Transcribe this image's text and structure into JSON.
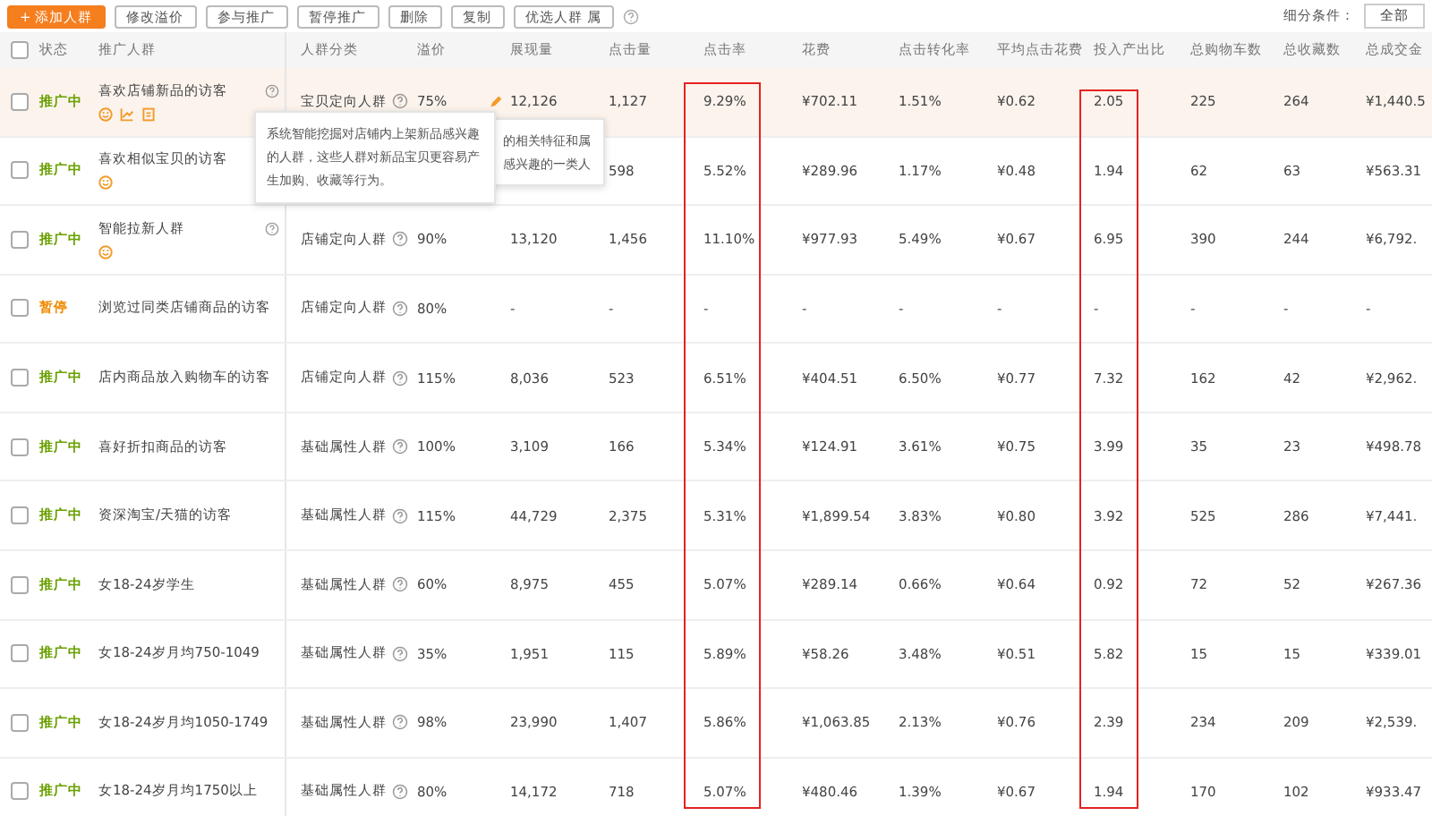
{
  "toolbar": {
    "buttons": [
      {
        "label": "+ 添加人群",
        "kind": "primary"
      },
      {
        "label": "修改溢价",
        "kind": "normal"
      },
      {
        "label": "参与推广",
        "kind": "normal"
      },
      {
        "label": "暂停推广",
        "kind": "normal"
      },
      {
        "label": "删除",
        "kind": "normal"
      },
      {
        "label": "复制",
        "kind": "normal"
      },
      {
        "label": "优选人群 属",
        "kind": "normal"
      }
    ],
    "filter_label": "细分条件：",
    "filter_value": "全部"
  },
  "table": {
    "select_all": {
      "checked": false
    },
    "columns": [
      "状态",
      "推广人群",
      "人群分类",
      "溢价",
      "展现量",
      "点击量",
      "点击率",
      "花费",
      "点击转化率",
      "平均点击花费",
      "投入产出比",
      "总购物车数",
      "总收藏数",
      "总成交金"
    ],
    "rows": [
      {
        "selected": true,
        "checked": false,
        "kind": "active",
        "name_help": true,
        "icons": [
          {
            "kind": "smile"
          },
          {
            "kind": "trend"
          },
          {
            "kind": "box"
          }
        ],
        "edit": true,
        "cells": [
          "推广中",
          "喜欢店铺新品的访客",
          "宝贝定向人群",
          "75%",
          "12,126",
          "1,127",
          "9.29%",
          "¥702.11",
          "1.51%",
          "¥0.62",
          "2.05",
          "225",
          "264",
          "¥1,440.5"
        ]
      },
      {
        "selected": false,
        "checked": false,
        "kind": "active",
        "name_help": false,
        "icons": [
          {
            "kind": "smile"
          }
        ],
        "edit": false,
        "cells": [
          "推广中",
          "喜欢相似宝贝的访客",
          null,
          null,
          null,
          "598",
          "5.52%",
          "¥289.96",
          "1.17%",
          "¥0.48",
          "1.94",
          "62",
          "63",
          "¥563.31"
        ]
      },
      {
        "selected": false,
        "checked": false,
        "kind": "active",
        "name_help": true,
        "icons": [
          {
            "kind": "smile"
          }
        ],
        "edit": false,
        "cells": [
          "推广中",
          "智能拉新人群",
          "店铺定向人群",
          "90%",
          "13,120",
          "1,456",
          "11.10%",
          "¥977.93",
          "5.49%",
          "¥0.67",
          "6.95",
          "390",
          "244",
          "¥6,792."
        ]
      },
      {
        "selected": false,
        "checked": false,
        "kind": "paused",
        "name_help": false,
        "icons": [],
        "edit": false,
        "cells": [
          "暂停",
          "浏览过同类店铺商品的访客",
          "店铺定向人群",
          "80%",
          "-",
          "-",
          "-",
          "-",
          "-",
          "-",
          "-",
          "-",
          "-",
          "-"
        ]
      },
      {
        "selected": false,
        "checked": false,
        "kind": "active",
        "name_help": false,
        "icons": [],
        "edit": false,
        "cells": [
          "推广中",
          "店内商品放入购物车的访客",
          "店铺定向人群",
          "115%",
          "8,036",
          "523",
          "6.51%",
          "¥404.51",
          "6.50%",
          "¥0.77",
          "7.32",
          "162",
          "42",
          "¥2,962."
        ]
      },
      {
        "selected": false,
        "checked": false,
        "kind": "active",
        "name_help": false,
        "icons": [],
        "edit": false,
        "cells": [
          "推广中",
          "喜好折扣商品的访客",
          "基础属性人群",
          "100%",
          "3,109",
          "166",
          "5.34%",
          "¥124.91",
          "3.61%",
          "¥0.75",
          "3.99",
          "35",
          "23",
          "¥498.78"
        ]
      },
      {
        "selected": false,
        "checked": false,
        "kind": "active",
        "name_help": false,
        "icons": [],
        "edit": false,
        "cells": [
          "推广中",
          "资深淘宝/天猫的访客",
          "基础属性人群",
          "115%",
          "44,729",
          "2,375",
          "5.31%",
          "¥1,899.54",
          "3.83%",
          "¥0.80",
          "3.92",
          "525",
          "286",
          "¥7,441."
        ]
      },
      {
        "selected": false,
        "checked": false,
        "kind": "active",
        "name_help": false,
        "icons": [],
        "edit": false,
        "cells": [
          "推广中",
          "女18-24岁学生",
          "基础属性人群",
          "60%",
          "8,975",
          "455",
          "5.07%",
          "¥289.14",
          "0.66%",
          "¥0.64",
          "0.92",
          "72",
          "52",
          "¥267.36"
        ]
      },
      {
        "selected": false,
        "checked": false,
        "kind": "active",
        "name_help": false,
        "icons": [],
        "edit": false,
        "cells": [
          "推广中",
          "女18-24岁月均750-1049",
          "基础属性人群",
          "35%",
          "1,951",
          "115",
          "5.89%",
          "¥58.26",
          "3.48%",
          "¥0.51",
          "5.82",
          "15",
          "15",
          "¥339.01"
        ]
      },
      {
        "selected": false,
        "checked": false,
        "kind": "active",
        "name_help": false,
        "icons": [],
        "edit": false,
        "cells": [
          "推广中",
          "女18-24岁月均1050-1749",
          "基础属性人群",
          "98%",
          "23,990",
          "1,407",
          "5.86%",
          "¥1,063.85",
          "2.13%",
          "¥0.76",
          "2.39",
          "234",
          "209",
          "¥2,539."
        ]
      },
      {
        "selected": false,
        "checked": false,
        "kind": "active",
        "name_help": false,
        "icons": [],
        "edit": false,
        "cells": [
          "推广中",
          "女18-24岁月均1750以上",
          "基础属性人群",
          "80%",
          "14,172",
          "718",
          "5.07%",
          "¥480.46",
          "1.39%",
          "¥0.67",
          "1.94",
          "170",
          "102",
          "¥933.47"
        ]
      }
    ]
  },
  "tooltips": [
    {
      "kind": "front",
      "lines": [
        "系统智能挖掘对店铺内上架新品感兴趣",
        "的人群，这些人群对新品宝贝更容易产",
        "生加购、收藏等行为。"
      ]
    },
    {
      "kind": "back",
      "lines": [
        "的相关特征和属",
        "感兴趣的一类人"
      ]
    }
  ]
}
